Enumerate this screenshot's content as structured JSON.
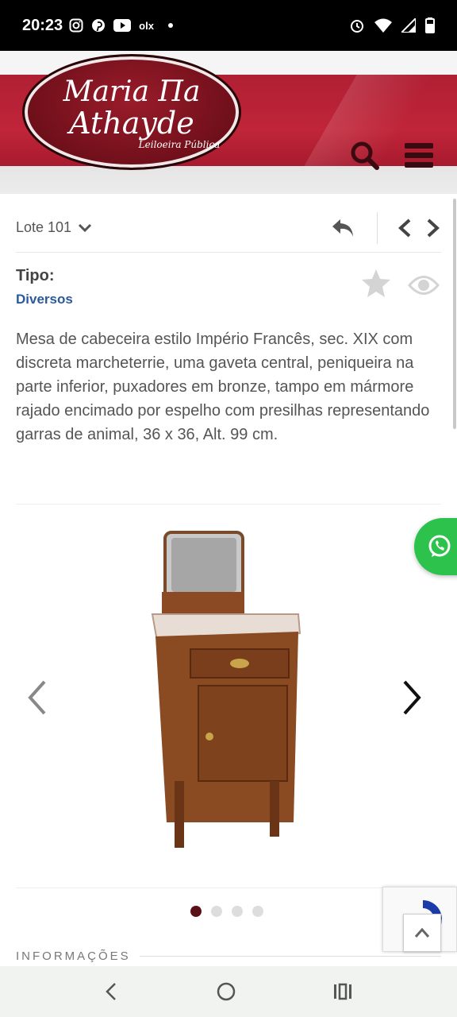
{
  "status_bar": {
    "time": "20:23",
    "left_icons": [
      "instagram-icon",
      "pinterest-icon",
      "youtube-icon",
      "olx-icon",
      "dot-icon"
    ],
    "olx_text": "olx",
    "right_icons": [
      "alarm-icon",
      "wifi-icon",
      "signal-icon",
      "battery-icon"
    ]
  },
  "header": {
    "logo_line1": "Maria Πa",
    "logo_line2": "Athayde",
    "logo_subtitle": "Leiloeira Pública",
    "colors": {
      "band": "#b01f33",
      "logo": "#6e0f1a",
      "icons": "#3a0a10"
    }
  },
  "lot": {
    "label": "Lote 101"
  },
  "details": {
    "tipo_label": "Tipo:",
    "tipo_value": "Diversos",
    "description": "Mesa de cabeceira estilo Império Francês, sec. XIX com discreta marcheterrie, uma gaveta central, peniqueira na parte inferior, puxadores em bronze, tampo em mármore rajado encimado por espelho com presilhas representando garras de animal, 36 x 36, Alt. 99 cm."
  },
  "gallery": {
    "total_images": 4,
    "active_index": 0
  },
  "section": {
    "info_label": "INFORMAÇÕES"
  },
  "accent_colors": {
    "link": "#2b5a9b",
    "whatsapp": "#2cc24b",
    "active_dot": "#5a1014"
  }
}
